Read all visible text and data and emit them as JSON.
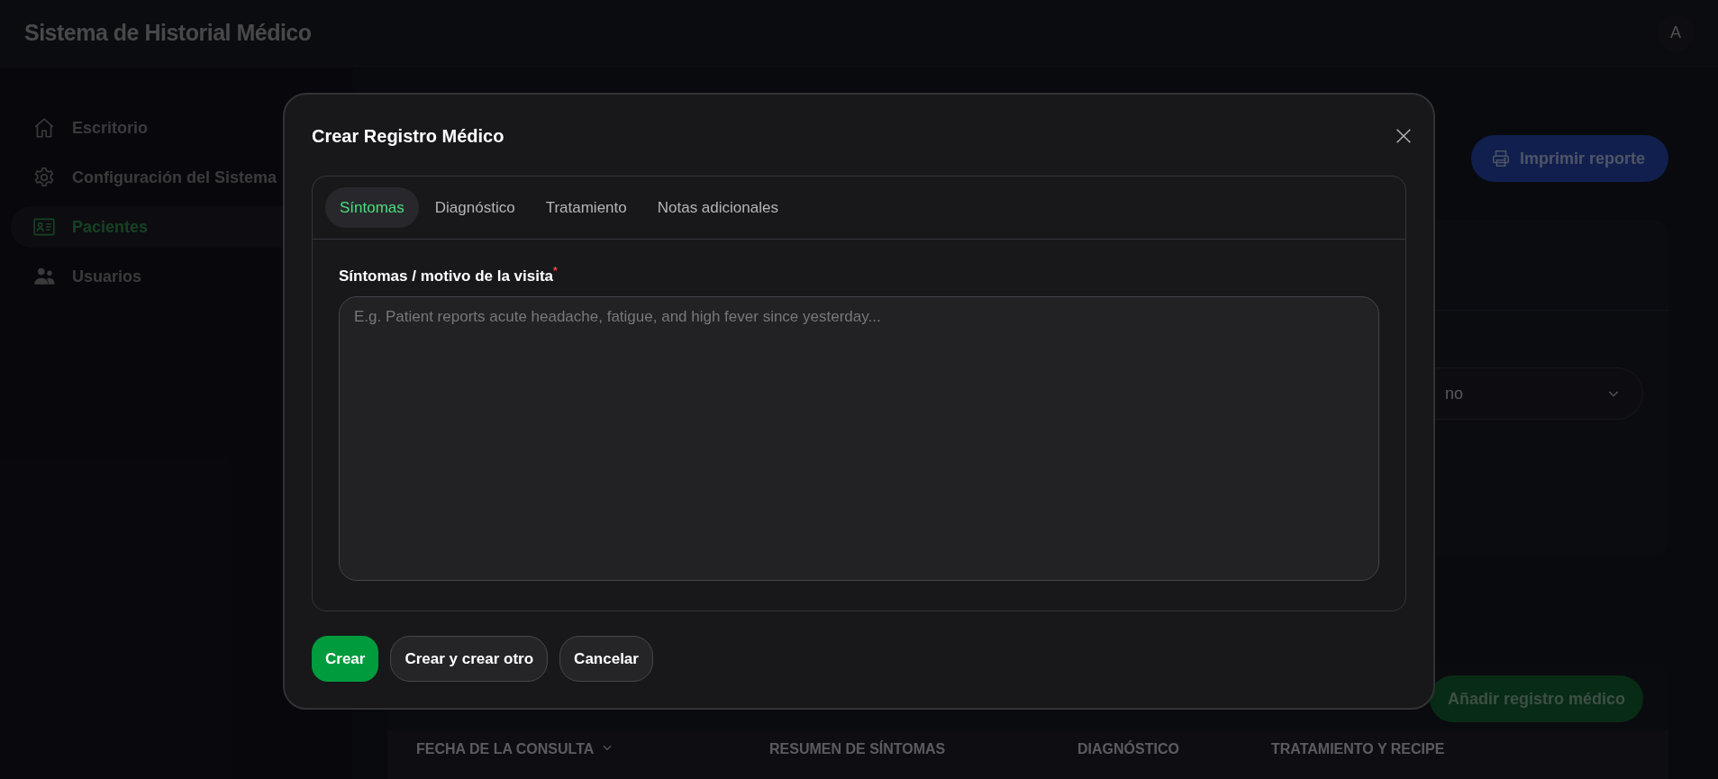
{
  "header": {
    "title": "Sistema de Historial Médico",
    "avatar": "A"
  },
  "sidebar": {
    "items": [
      {
        "label": "Escritorio",
        "selected": false
      },
      {
        "label": "Configuración del Sistema",
        "selected": false
      },
      {
        "label": "Pacientes",
        "selected": true
      },
      {
        "label": "Usuarios",
        "selected": false
      }
    ]
  },
  "page": {
    "print_button": "Imprimir reporte",
    "filter_select": {
      "value": "no"
    },
    "add_button": "Añadir registro médico",
    "table": {
      "columns": [
        {
          "label": "FECHA DE LA CONSULTA",
          "sortable": true
        },
        {
          "label": "RESUMEN DE SÍNTOMAS",
          "sortable": false
        },
        {
          "label": "DIAGNÓSTICO",
          "sortable": false
        },
        {
          "label": "TRATAMIENTO Y RECIPE",
          "sortable": false
        }
      ]
    }
  },
  "modal": {
    "title": "Crear Registro Médico",
    "tabs": [
      {
        "label": "Síntomas",
        "selected": true
      },
      {
        "label": "Diagnóstico",
        "selected": false
      },
      {
        "label": "Tratamiento",
        "selected": false
      },
      {
        "label": "Notas adicionales",
        "selected": false
      }
    ],
    "field": {
      "label": "Síntomas / motivo de la visita",
      "required_mark": "*",
      "placeholder": "E.g. Patient reports acute headache, fatigue, and high fever since yesterday..."
    },
    "buttons": [
      {
        "label": "Crear",
        "kind": "primary"
      },
      {
        "label": "Crear y crear otro",
        "kind": "secondary"
      },
      {
        "label": "Cancelar",
        "kind": "secondary"
      }
    ]
  }
}
